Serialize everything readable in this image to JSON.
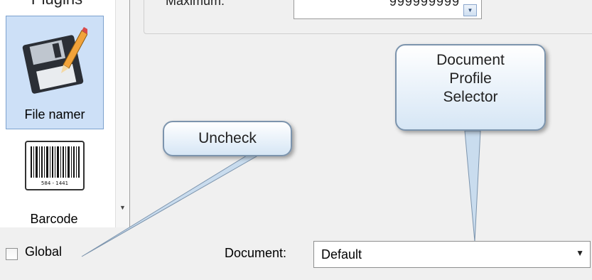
{
  "sidebar": {
    "heading_partial": "Plugins",
    "items": [
      {
        "label": "File namer",
        "icon": "floppy-pencil-icon",
        "selected": true
      },
      {
        "label": "Barcode",
        "icon": "barcode-icon",
        "icon_text": "584 - 1441",
        "selected": false
      }
    ]
  },
  "settings": {
    "maximum_label": "Maximum:",
    "maximum_value": "999999999"
  },
  "callouts": {
    "uncheck": "Uncheck",
    "document_profile_lines": [
      "Document",
      "Profile",
      "Selector"
    ]
  },
  "footer": {
    "global_label": "Global",
    "global_checked": false,
    "document_label": "Document:",
    "document_value": "Default"
  },
  "colors": {
    "selection_bg": "#cde0f7",
    "selection_border": "#7da2ce",
    "callout_border": "#7c94ad"
  }
}
